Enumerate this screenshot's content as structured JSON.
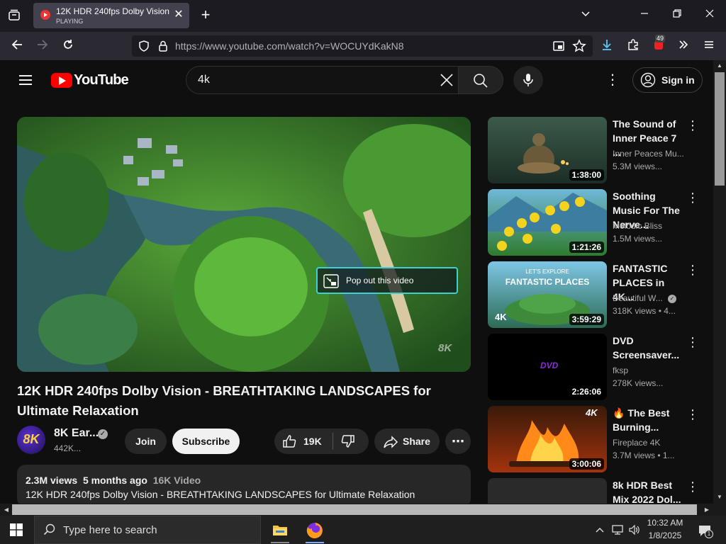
{
  "browser": {
    "tab_title": "12K HDR 240fps Dolby Vision - |",
    "tab_status": "PLAYING",
    "url_host": "https://www.youtube.com",
    "url_path": "/watch?v=WOCUYdKakN8",
    "extension_badge": "49"
  },
  "youtube": {
    "logo_text": "YouTube",
    "search_value": "4k",
    "signin_label": "Sign in"
  },
  "video": {
    "popout_label": "Pop out this video",
    "watermark": "8K",
    "title": "12K HDR 240fps Dolby Vision - BREATHTAKING LANDSCAPES for Ultimate Relaxation",
    "channel_name": "8K Ear...",
    "channel_subs": "442K...",
    "channel_avatar_text": "8K",
    "join_label": "Join",
    "subscribe_label": "Subscribe",
    "likes": "19K",
    "share_label": "Share",
    "views": "2.3M views",
    "age": "5 months ago",
    "tag": "16K Video",
    "desc_line": "12K HDR 240fps Dolby Vision - BREATHTAKING LANDSCAPES for Ultimate Relaxation"
  },
  "related": [
    {
      "title": "The Sound of Inner Peace 7 ...",
      "channel": "Inner Peaces Mu...",
      "meta": "5.3M views...",
      "duration": "1:38:00"
    },
    {
      "title": "Soothing Music For The Nerve...",
      "channel": "Melodic Bliss",
      "meta": "1.5M views...",
      "duration": "1:21:26"
    },
    {
      "title": "FANTASTIC PLACES in 4K...",
      "channel": "Beautiful W...",
      "meta": "318K views  • 4...",
      "duration": "3:59:29",
      "thumb_line1": "LET'S EXPLORE",
      "thumb_line2": "FANTASTIC PLACES",
      "thumb_badge": "4K"
    },
    {
      "title": "DVD Screensaver...",
      "channel": "fksp",
      "meta": "278K views...",
      "duration": "2:26:06",
      "thumb_text": "DVD"
    },
    {
      "title": "🔥 The Best Burning...",
      "channel": "Fireplace 4K",
      "meta": "3.7M views  • 1...",
      "duration": "3:00:06",
      "thumb_badge": "4K"
    },
    {
      "title": "8k HDR Best Mix 2022 Dol...",
      "channel": "",
      "meta": "",
      "duration": ""
    }
  ],
  "taskbar": {
    "search_placeholder": "Type here to search",
    "time": "10:32 AM",
    "date": "1/8/2025",
    "notification_count": "1"
  }
}
